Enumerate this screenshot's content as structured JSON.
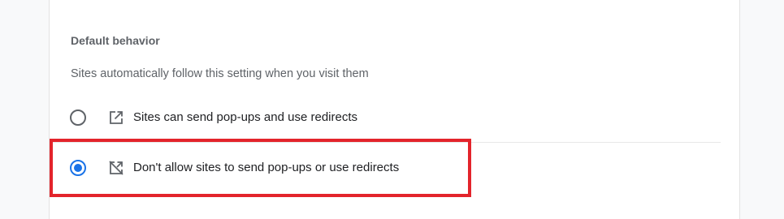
{
  "section": {
    "title": "Default behavior",
    "description": "Sites automatically follow this setting when you visit them"
  },
  "options": [
    {
      "label": "Sites can send pop-ups and use redirects",
      "icon": "open-in-new-icon",
      "selected": false
    },
    {
      "label": "Don't allow sites to send pop-ups or use redirects",
      "icon": "open-in-new-off-icon",
      "selected": true
    }
  ],
  "colors": {
    "accent": "#1a73e8",
    "highlight": "#e3242b",
    "secondary_text": "#5f6368",
    "primary_text": "#202124"
  }
}
